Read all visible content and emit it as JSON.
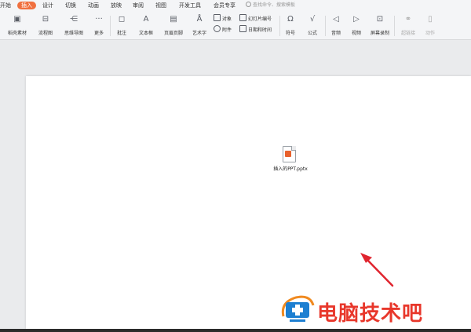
{
  "menu": {
    "items": [
      {
        "label": "开始",
        "active": false
      },
      {
        "label": "插入",
        "active": true
      },
      {
        "label": "设计",
        "active": false
      },
      {
        "label": "切换",
        "active": false
      },
      {
        "label": "动画",
        "active": false
      },
      {
        "label": "放映",
        "active": false
      },
      {
        "label": "审阅",
        "active": false
      },
      {
        "label": "视图",
        "active": false
      },
      {
        "label": "开发工具",
        "active": false
      },
      {
        "label": "会员专享",
        "active": false
      }
    ],
    "search_placeholder": "查找命令、搜索模板"
  },
  "ribbon": {
    "tools": [
      {
        "label": "稻壳素材",
        "icon": "image-icon"
      },
      {
        "label": "流程图",
        "icon": "flowchart-icon"
      },
      {
        "label": "思维导图",
        "icon": "mindmap-icon"
      },
      {
        "label": "更多",
        "icon": "more-icon"
      },
      {
        "label": "批注",
        "icon": "comment-icon"
      },
      {
        "label": "文本框",
        "icon": "textbox-icon"
      },
      {
        "label": "页眉页脚",
        "icon": "header-footer-icon"
      },
      {
        "label": "艺术字",
        "icon": "wordart-icon"
      },
      {
        "label": "符号",
        "icon": "omega-icon"
      },
      {
        "label": "公式",
        "icon": "formula-icon"
      },
      {
        "label": "音频",
        "icon": "audio-icon"
      },
      {
        "label": "视频",
        "icon": "video-icon"
      },
      {
        "label": "屏幕录制",
        "icon": "screen-record-icon"
      },
      {
        "label": "超链接",
        "icon": "link-icon",
        "disabled": true
      },
      {
        "label": "动作",
        "icon": "mouse-icon",
        "disabled": true
      }
    ],
    "small": {
      "object": "对象",
      "attachment": "附件",
      "slide_number": "幻灯片编号",
      "datetime": "日期和时间"
    }
  },
  "slide": {
    "file_name": "插入的PPT.pptx"
  },
  "watermark": {
    "text": "电脑技术吧"
  },
  "colors": {
    "accent": "#f0703f",
    "arrow": "#e0252f",
    "watermark": "#e8372b"
  }
}
